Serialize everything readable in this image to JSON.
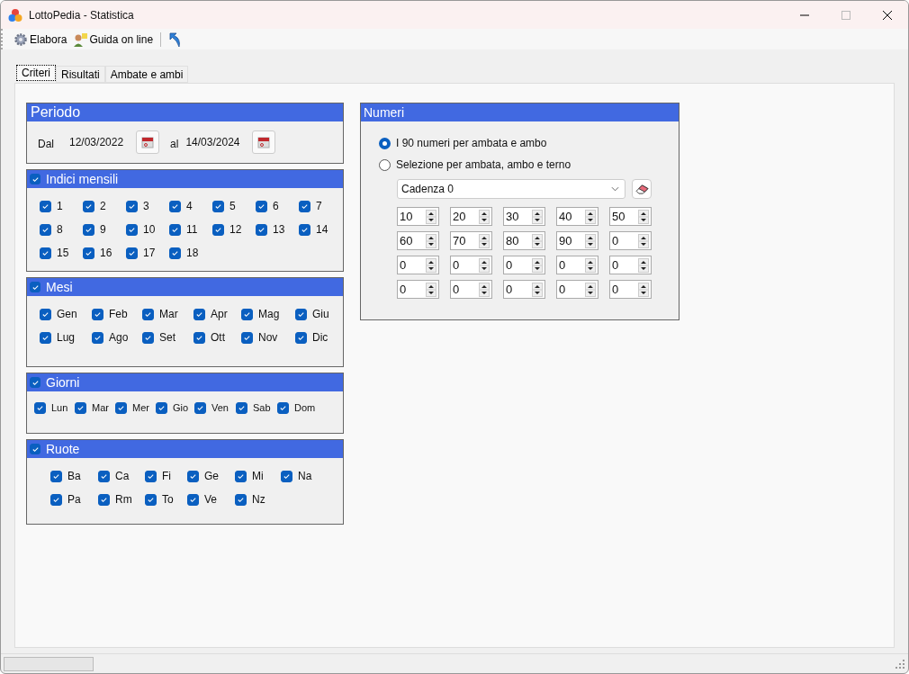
{
  "window": {
    "title": "LottoPedia - Statistica"
  },
  "toolbar": [
    {
      "kind": "gear",
      "label": "Elabora"
    },
    {
      "kind": "help",
      "label": "Guida on line"
    },
    {
      "kind": "back"
    }
  ],
  "tabs": [
    {
      "label": "Criteri",
      "selected": true
    },
    {
      "label": "Risultati",
      "selected": false
    },
    {
      "label": "Ambate e ambi",
      "selected": false
    }
  ],
  "periodo": {
    "title": "Periodo",
    "from_label": "Dal",
    "from": "12/03/2022",
    "to_label": "al",
    "to": "14/03/2024"
  },
  "groups": [
    {
      "title": "Indici mensili",
      "checked": true,
      "items": [
        {
          "label": "1",
          "checked": true
        },
        {
          "label": "2",
          "checked": true
        },
        {
          "label": "3",
          "checked": true
        },
        {
          "label": "4",
          "checked": true
        },
        {
          "label": "5",
          "checked": true
        },
        {
          "label": "6",
          "checked": true
        },
        {
          "label": "7",
          "checked": true
        },
        {
          "label": "8",
          "checked": true
        },
        {
          "label": "9",
          "checked": true
        },
        {
          "label": "10",
          "checked": true
        },
        {
          "label": "11",
          "checked": true
        },
        {
          "label": "12",
          "checked": true
        },
        {
          "label": "13",
          "checked": true
        },
        {
          "label": "14",
          "checked": true
        },
        {
          "label": "15",
          "checked": true
        },
        {
          "label": "16",
          "checked": true
        },
        {
          "label": "17",
          "checked": true
        },
        {
          "label": "18",
          "checked": true
        }
      ]
    },
    {
      "title": "Mesi",
      "checked": true,
      "items": [
        {
          "label": "Gen",
          "checked": true
        },
        {
          "label": "Feb",
          "checked": true
        },
        {
          "label": "Mar",
          "checked": true
        },
        {
          "label": "Apr",
          "checked": true
        },
        {
          "label": "Mag",
          "checked": true
        },
        {
          "label": "Giu",
          "checked": true
        },
        {
          "label": "Lug",
          "checked": true
        },
        {
          "label": "Ago",
          "checked": true
        },
        {
          "label": "Set",
          "checked": true
        },
        {
          "label": "Ott",
          "checked": true
        },
        {
          "label": "Nov",
          "checked": true
        },
        {
          "label": "Dic",
          "checked": true
        }
      ]
    },
    {
      "title": "Giorni",
      "checked": true,
      "items": [
        {
          "label": "Lun",
          "checked": true
        },
        {
          "label": "Mar",
          "checked": true
        },
        {
          "label": "Mer",
          "checked": true
        },
        {
          "label": "Gio",
          "checked": true
        },
        {
          "label": "Ven",
          "checked": true
        },
        {
          "label": "Sab",
          "checked": true
        },
        {
          "label": "Dom",
          "checked": true
        }
      ]
    },
    {
      "title": "Ruote",
      "checked": true,
      "items": [
        {
          "label": "Ba",
          "checked": true
        },
        {
          "label": "Ca",
          "checked": true
        },
        {
          "label": "Fi",
          "checked": true
        },
        {
          "label": "Ge",
          "checked": true
        },
        {
          "label": "Mi",
          "checked": true
        },
        {
          "label": "Na",
          "checked": true
        },
        {
          "label": "Pa",
          "checked": true
        },
        {
          "label": "Rm",
          "checked": true
        },
        {
          "label": "To",
          "checked": true
        },
        {
          "label": "Ve",
          "checked": true
        },
        {
          "label": "Nz",
          "checked": true
        }
      ]
    }
  ],
  "numeri": {
    "title": "Numeri",
    "options": [
      {
        "label": "I 90 numeri per ambata e ambo",
        "selected": true
      },
      {
        "label": "Selezione per ambata, ambo e terno",
        "selected": false
      }
    ],
    "combo": "Cadenza 0",
    "spinners": [
      "10",
      "20",
      "30",
      "40",
      "50",
      "60",
      "70",
      "80",
      "90",
      "0",
      "0",
      "0",
      "0",
      "0",
      "0",
      "0",
      "0",
      "0",
      "0",
      "0"
    ]
  },
  "status_bar": {
    "progress": {
      "level": 0
    }
  }
}
